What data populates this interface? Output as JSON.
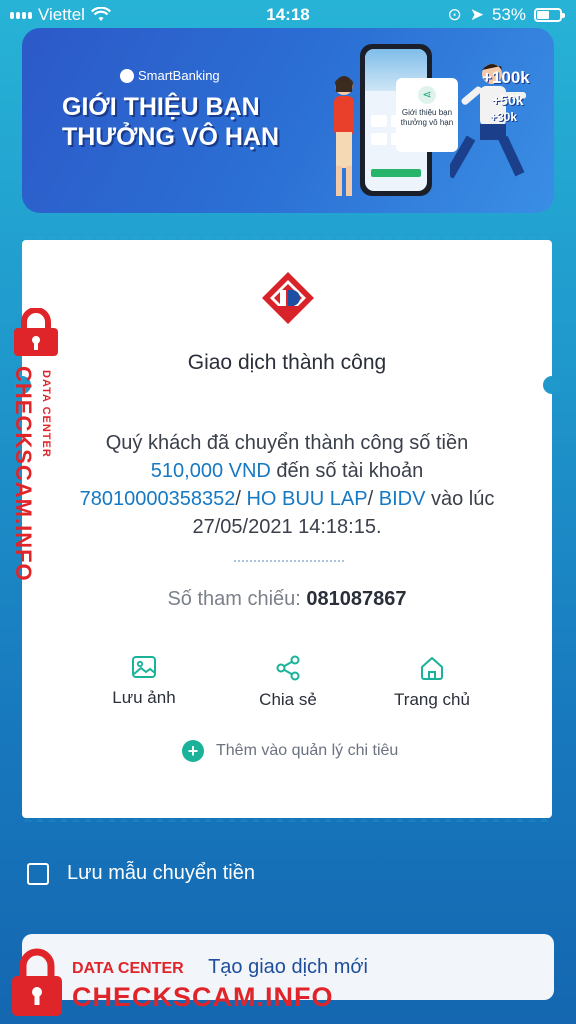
{
  "status_bar": {
    "carrier": "Viettel",
    "time": "14:18",
    "battery": "53%"
  },
  "banner": {
    "brand": "SmartBanking",
    "headline_line1": "GIỚI THIỆU BẠN",
    "headline_line2": "THƯỞNG VÔ HẠN",
    "popup_text": "Giới thiệu bạn thưởng vô hạn",
    "bonus": [
      "+100k",
      "+50k",
      "+30k"
    ]
  },
  "receipt": {
    "title": "Giao dịch thành công",
    "msg_part1": "Quý khách đã chuyển thành công số tiền",
    "amount": "510,000 VND",
    "msg_part2": " đến số tài khoản",
    "account": "78010000358352",
    "sep1": "/ ",
    "recipient": "HO BUU LAP",
    "sep2": "/ ",
    "bank": "BIDV",
    "msg_part3": " vào lúc",
    "datetime": "27/05/2021 14:18:15.",
    "ref_label": "Số tham chiếu: ",
    "ref_value": "081087867",
    "actions": [
      {
        "label": "Lưu ảnh",
        "icon": "image-icon"
      },
      {
        "label": "Chia sẻ",
        "icon": "share-icon"
      },
      {
        "label": "Trang chủ",
        "icon": "home-icon"
      }
    ],
    "add_expense": "Thêm vào quản lý chi tiêu"
  },
  "save_template": {
    "label": "Lưu mẫu chuyển tiền",
    "checked": false
  },
  "new_transaction": {
    "label": "Tạo giao dịch mới"
  },
  "watermark": {
    "sub": "DATA CENTER",
    "main": "CHECKSCAM.INFO"
  },
  "colors": {
    "accent": "#1679c4",
    "teal": "#1ab39a",
    "watermark": "#e0252a"
  }
}
